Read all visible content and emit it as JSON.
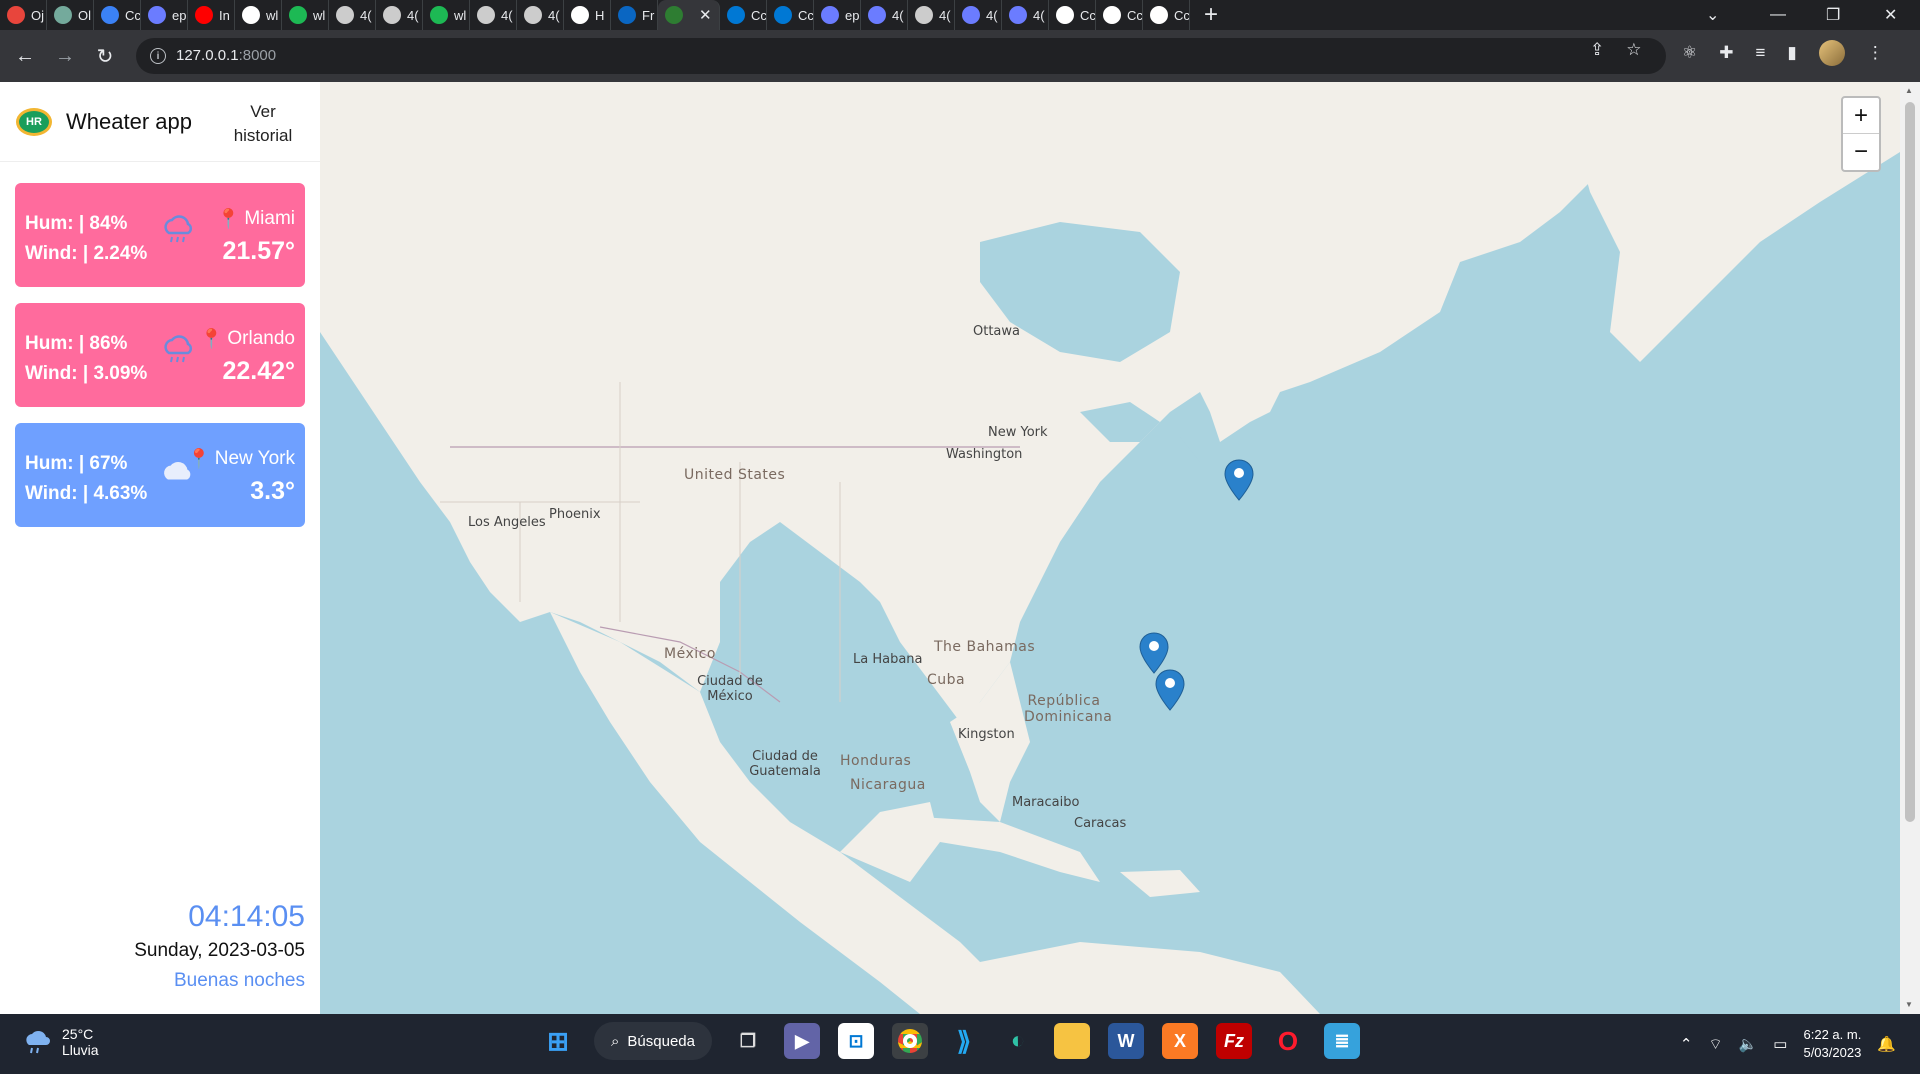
{
  "browser": {
    "tabs": [
      {
        "label": "Oj",
        "icon": "fox-icon",
        "color": "#e8453c"
      },
      {
        "label": "Ol",
        "icon": "openai-icon",
        "color": "#74aa9c"
      },
      {
        "label": "Cc",
        "icon": "loader-icon",
        "color": "#3b82f6"
      },
      {
        "label": "ep",
        "icon": "infinity-icon",
        "color": "#6b7cff"
      },
      {
        "label": "In",
        "icon": "youtube-icon",
        "color": "#ff0000"
      },
      {
        "label": "wl",
        "icon": "github-icon",
        "color": "#ffffff"
      },
      {
        "label": "wl",
        "icon": "spotify-icon",
        "color": "#1db954"
      },
      {
        "label": "4(",
        "icon": "globe-icon",
        "color": "#cccccc"
      },
      {
        "label": "4(",
        "icon": "globe-icon",
        "color": "#cccccc"
      },
      {
        "label": "wl",
        "icon": "spotify-icon",
        "color": "#1db954"
      },
      {
        "label": "4(",
        "icon": "globe-icon",
        "color": "#cccccc"
      },
      {
        "label": "4(",
        "icon": "globe-icon",
        "color": "#cccccc"
      },
      {
        "label": "H",
        "icon": "github-icon",
        "color": "#ffffff"
      },
      {
        "label": "Fr",
        "icon": "linkedin-icon",
        "color": "#0a66c2"
      },
      {
        "label": "",
        "icon": "app-favicon-icon",
        "color": "#2e7d32",
        "active": true
      },
      {
        "label": "Cc",
        "icon": "outlook-icon",
        "color": "#0078d4"
      },
      {
        "label": "Cc",
        "icon": "outlook-icon",
        "color": "#0078d4"
      },
      {
        "label": "ep",
        "icon": "infinity-icon",
        "color": "#6b7cff"
      },
      {
        "label": "4(",
        "icon": "infinity-icon",
        "color": "#6b7cff"
      },
      {
        "label": "4(",
        "icon": "globe-icon",
        "color": "#cccccc"
      },
      {
        "label": "4(",
        "icon": "infinity-icon",
        "color": "#6b7cff"
      },
      {
        "label": "4(",
        "icon": "infinity-icon",
        "color": "#6b7cff"
      },
      {
        "label": "Cc",
        "icon": "gear-icon",
        "color": "#ffffff"
      },
      {
        "label": "Cc",
        "icon": "gear-icon",
        "color": "#ffffff"
      },
      {
        "label": "Cc",
        "icon": "gear-icon",
        "color": "#ffffff"
      }
    ],
    "new_tab": "+",
    "url_host": "127.0.0.1",
    "url_port": ":8000"
  },
  "app": {
    "name": "Wheater app",
    "logo_text": "HR",
    "history_label": "Ver historial"
  },
  "cards": [
    {
      "hum": "Hum: | 84%",
      "wind": "Wind: | 2.24%",
      "city": "Miami",
      "temp": "21.57°",
      "icon": "rain-cloud-icon",
      "color": "#ff6b9d"
    },
    {
      "hum": "Hum: | 86%",
      "wind": "Wind: | 3.09%",
      "city": "Orlando",
      "temp": "22.42°",
      "icon": "rain-cloud-icon",
      "color": "#ff6b9d"
    },
    {
      "hum": "Hum: | 67%",
      "wind": "Wind: | 4.63%",
      "city": "New York",
      "temp": "3.3°",
      "icon": "cloud-icon",
      "color": "#6fa0ff"
    }
  ],
  "clock": {
    "time": "04:14:05",
    "date": "Sunday, 2023-03-05",
    "greeting": "Buenas noches"
  },
  "map": {
    "labels": {
      "ottawa": "Ottawa",
      "new_york": "New York",
      "washington": "Washington",
      "united_states": "United States",
      "phoenix": "Phoenix",
      "los_angeles": "Los Angeles",
      "mexico": "México",
      "ciudad_de_mexico": "Ciudad de México",
      "la_habana": "La Habana",
      "the_bahamas": "The Bahamas",
      "cuba": "Cuba",
      "republica_dominicana": "República Dominicana",
      "kingston": "Kingston",
      "ciudad_de_guatemala": "Ciudad de Guatemala",
      "honduras": "Honduras",
      "nicaragua": "Nicaragua",
      "maracaibo": "Maracaibo",
      "caracas": "Caracas"
    },
    "zoom_in": "+",
    "zoom_out": "−"
  },
  "taskbar": {
    "weather_temp": "25°C",
    "weather_desc": "Lluvia",
    "search_label": "Búsqueda",
    "time": "6:22 a. m.",
    "date": "5/03/2023"
  }
}
